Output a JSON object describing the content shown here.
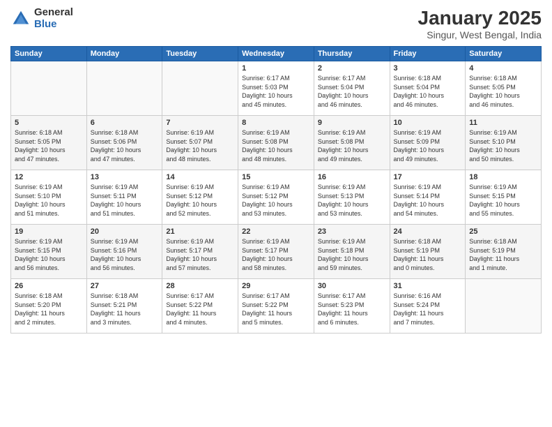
{
  "logo": {
    "general": "General",
    "blue": "Blue"
  },
  "title": "January 2025",
  "subtitle": "Singur, West Bengal, India",
  "days_of_week": [
    "Sunday",
    "Monday",
    "Tuesday",
    "Wednesday",
    "Thursday",
    "Friday",
    "Saturday"
  ],
  "weeks": [
    [
      {
        "day": "",
        "info": ""
      },
      {
        "day": "",
        "info": ""
      },
      {
        "day": "",
        "info": ""
      },
      {
        "day": "1",
        "info": "Sunrise: 6:17 AM\nSunset: 5:03 PM\nDaylight: 10 hours\nand 45 minutes."
      },
      {
        "day": "2",
        "info": "Sunrise: 6:17 AM\nSunset: 5:04 PM\nDaylight: 10 hours\nand 46 minutes."
      },
      {
        "day": "3",
        "info": "Sunrise: 6:18 AM\nSunset: 5:04 PM\nDaylight: 10 hours\nand 46 minutes."
      },
      {
        "day": "4",
        "info": "Sunrise: 6:18 AM\nSunset: 5:05 PM\nDaylight: 10 hours\nand 46 minutes."
      }
    ],
    [
      {
        "day": "5",
        "info": "Sunrise: 6:18 AM\nSunset: 5:05 PM\nDaylight: 10 hours\nand 47 minutes."
      },
      {
        "day": "6",
        "info": "Sunrise: 6:18 AM\nSunset: 5:06 PM\nDaylight: 10 hours\nand 47 minutes."
      },
      {
        "day": "7",
        "info": "Sunrise: 6:19 AM\nSunset: 5:07 PM\nDaylight: 10 hours\nand 48 minutes."
      },
      {
        "day": "8",
        "info": "Sunrise: 6:19 AM\nSunset: 5:08 PM\nDaylight: 10 hours\nand 48 minutes."
      },
      {
        "day": "9",
        "info": "Sunrise: 6:19 AM\nSunset: 5:08 PM\nDaylight: 10 hours\nand 49 minutes."
      },
      {
        "day": "10",
        "info": "Sunrise: 6:19 AM\nSunset: 5:09 PM\nDaylight: 10 hours\nand 49 minutes."
      },
      {
        "day": "11",
        "info": "Sunrise: 6:19 AM\nSunset: 5:10 PM\nDaylight: 10 hours\nand 50 minutes."
      }
    ],
    [
      {
        "day": "12",
        "info": "Sunrise: 6:19 AM\nSunset: 5:10 PM\nDaylight: 10 hours\nand 51 minutes."
      },
      {
        "day": "13",
        "info": "Sunrise: 6:19 AM\nSunset: 5:11 PM\nDaylight: 10 hours\nand 51 minutes."
      },
      {
        "day": "14",
        "info": "Sunrise: 6:19 AM\nSunset: 5:12 PM\nDaylight: 10 hours\nand 52 minutes."
      },
      {
        "day": "15",
        "info": "Sunrise: 6:19 AM\nSunset: 5:12 PM\nDaylight: 10 hours\nand 53 minutes."
      },
      {
        "day": "16",
        "info": "Sunrise: 6:19 AM\nSunset: 5:13 PM\nDaylight: 10 hours\nand 53 minutes."
      },
      {
        "day": "17",
        "info": "Sunrise: 6:19 AM\nSunset: 5:14 PM\nDaylight: 10 hours\nand 54 minutes."
      },
      {
        "day": "18",
        "info": "Sunrise: 6:19 AM\nSunset: 5:15 PM\nDaylight: 10 hours\nand 55 minutes."
      }
    ],
    [
      {
        "day": "19",
        "info": "Sunrise: 6:19 AM\nSunset: 5:15 PM\nDaylight: 10 hours\nand 56 minutes."
      },
      {
        "day": "20",
        "info": "Sunrise: 6:19 AM\nSunset: 5:16 PM\nDaylight: 10 hours\nand 56 minutes."
      },
      {
        "day": "21",
        "info": "Sunrise: 6:19 AM\nSunset: 5:17 PM\nDaylight: 10 hours\nand 57 minutes."
      },
      {
        "day": "22",
        "info": "Sunrise: 6:19 AM\nSunset: 5:17 PM\nDaylight: 10 hours\nand 58 minutes."
      },
      {
        "day": "23",
        "info": "Sunrise: 6:19 AM\nSunset: 5:18 PM\nDaylight: 10 hours\nand 59 minutes."
      },
      {
        "day": "24",
        "info": "Sunrise: 6:18 AM\nSunset: 5:19 PM\nDaylight: 11 hours\nand 0 minutes."
      },
      {
        "day": "25",
        "info": "Sunrise: 6:18 AM\nSunset: 5:19 PM\nDaylight: 11 hours\nand 1 minute."
      }
    ],
    [
      {
        "day": "26",
        "info": "Sunrise: 6:18 AM\nSunset: 5:20 PM\nDaylight: 11 hours\nand 2 minutes."
      },
      {
        "day": "27",
        "info": "Sunrise: 6:18 AM\nSunset: 5:21 PM\nDaylight: 11 hours\nand 3 minutes."
      },
      {
        "day": "28",
        "info": "Sunrise: 6:17 AM\nSunset: 5:22 PM\nDaylight: 11 hours\nand 4 minutes."
      },
      {
        "day": "29",
        "info": "Sunrise: 6:17 AM\nSunset: 5:22 PM\nDaylight: 11 hours\nand 5 minutes."
      },
      {
        "day": "30",
        "info": "Sunrise: 6:17 AM\nSunset: 5:23 PM\nDaylight: 11 hours\nand 6 minutes."
      },
      {
        "day": "31",
        "info": "Sunrise: 6:16 AM\nSunset: 5:24 PM\nDaylight: 11 hours\nand 7 minutes."
      },
      {
        "day": "",
        "info": ""
      }
    ]
  ]
}
